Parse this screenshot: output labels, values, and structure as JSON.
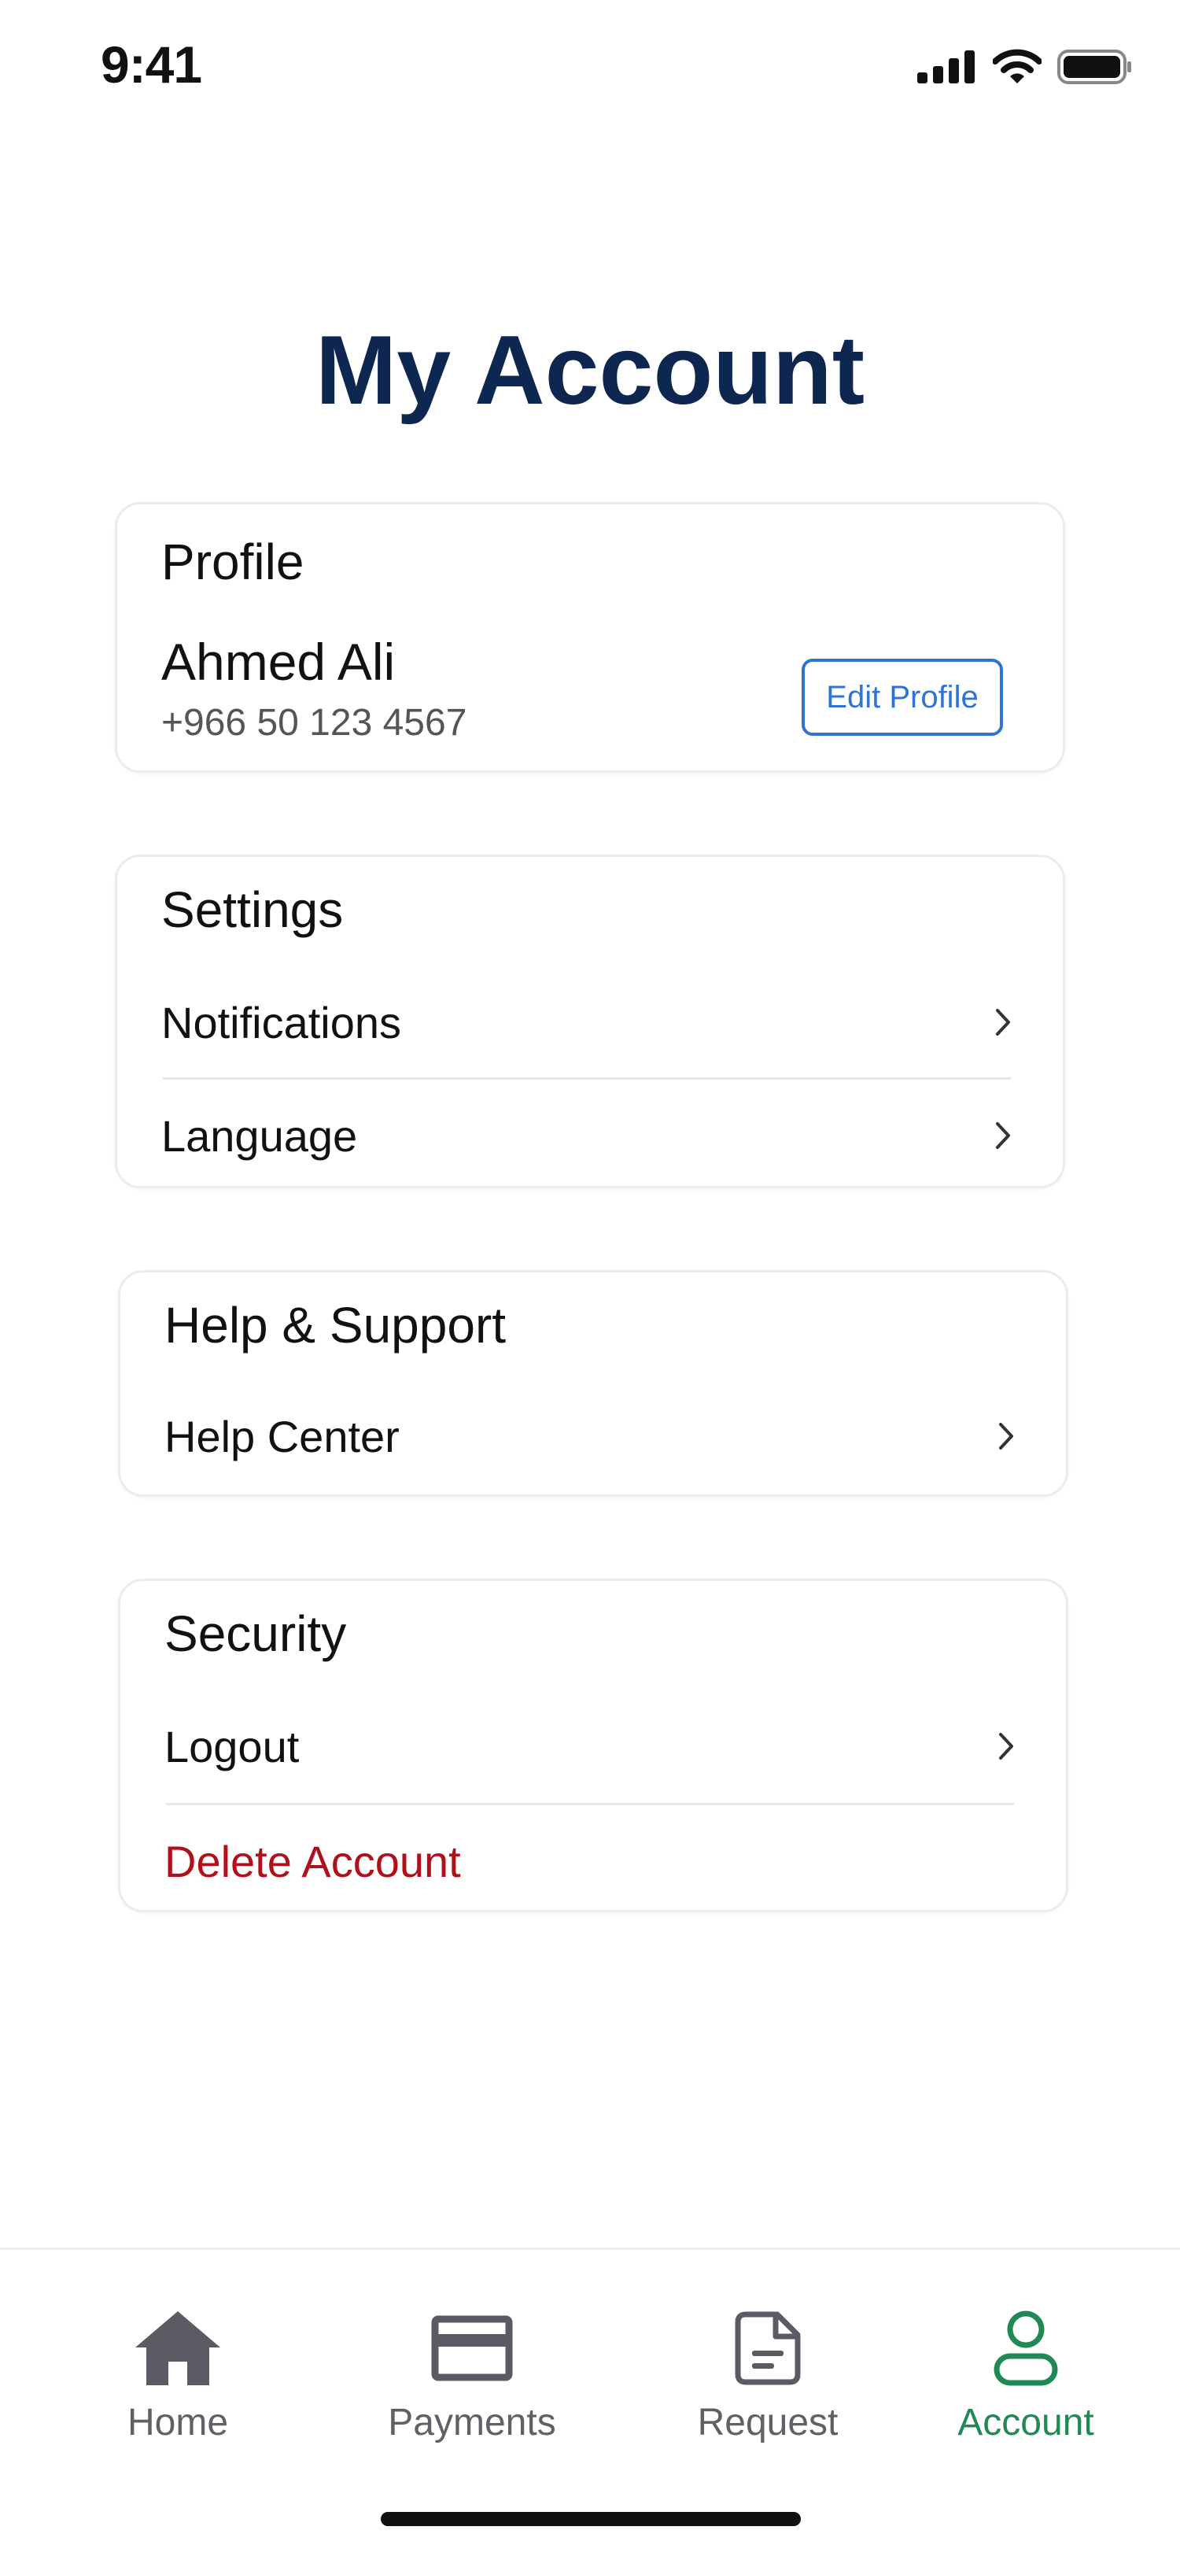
{
  "status_bar": {
    "time": "9:41",
    "icons": [
      "signal-icon",
      "wifi-icon",
      "battery-icon"
    ]
  },
  "page": {
    "title": "My Account"
  },
  "profile": {
    "title": "Profile",
    "name": "Ahmed Ali",
    "phone": "+966 50 123 4567",
    "edit_label": "Edit Profile"
  },
  "settings": {
    "title": "Settings",
    "items": [
      {
        "label": "Notifications",
        "icon": "chevron-right-icon"
      },
      {
        "label": "Language",
        "icon": "chevron-right-icon"
      }
    ]
  },
  "help": {
    "title": "Help & Support",
    "items": [
      {
        "label": "Help Center",
        "icon": "chevron-right-icon"
      }
    ]
  },
  "security": {
    "title": "Security",
    "items": [
      {
        "label": "Logout",
        "icon": "chevron-right-icon"
      },
      {
        "label": "Delete Account"
      }
    ]
  },
  "tab_bar": {
    "active": "Account",
    "tabs": [
      {
        "label": "Home",
        "icon": "home-icon"
      },
      {
        "label": "Payments",
        "icon": "card-icon"
      },
      {
        "label": "Request",
        "icon": "document-icon"
      },
      {
        "label": "Account",
        "icon": "user-icon"
      }
    ]
  },
  "colors": {
    "title": "#0d2750",
    "accent_blue": "#2f74d2",
    "active_tab": "#1f8a55",
    "inactive_tab": "#606066",
    "danger": "#b0101a"
  }
}
